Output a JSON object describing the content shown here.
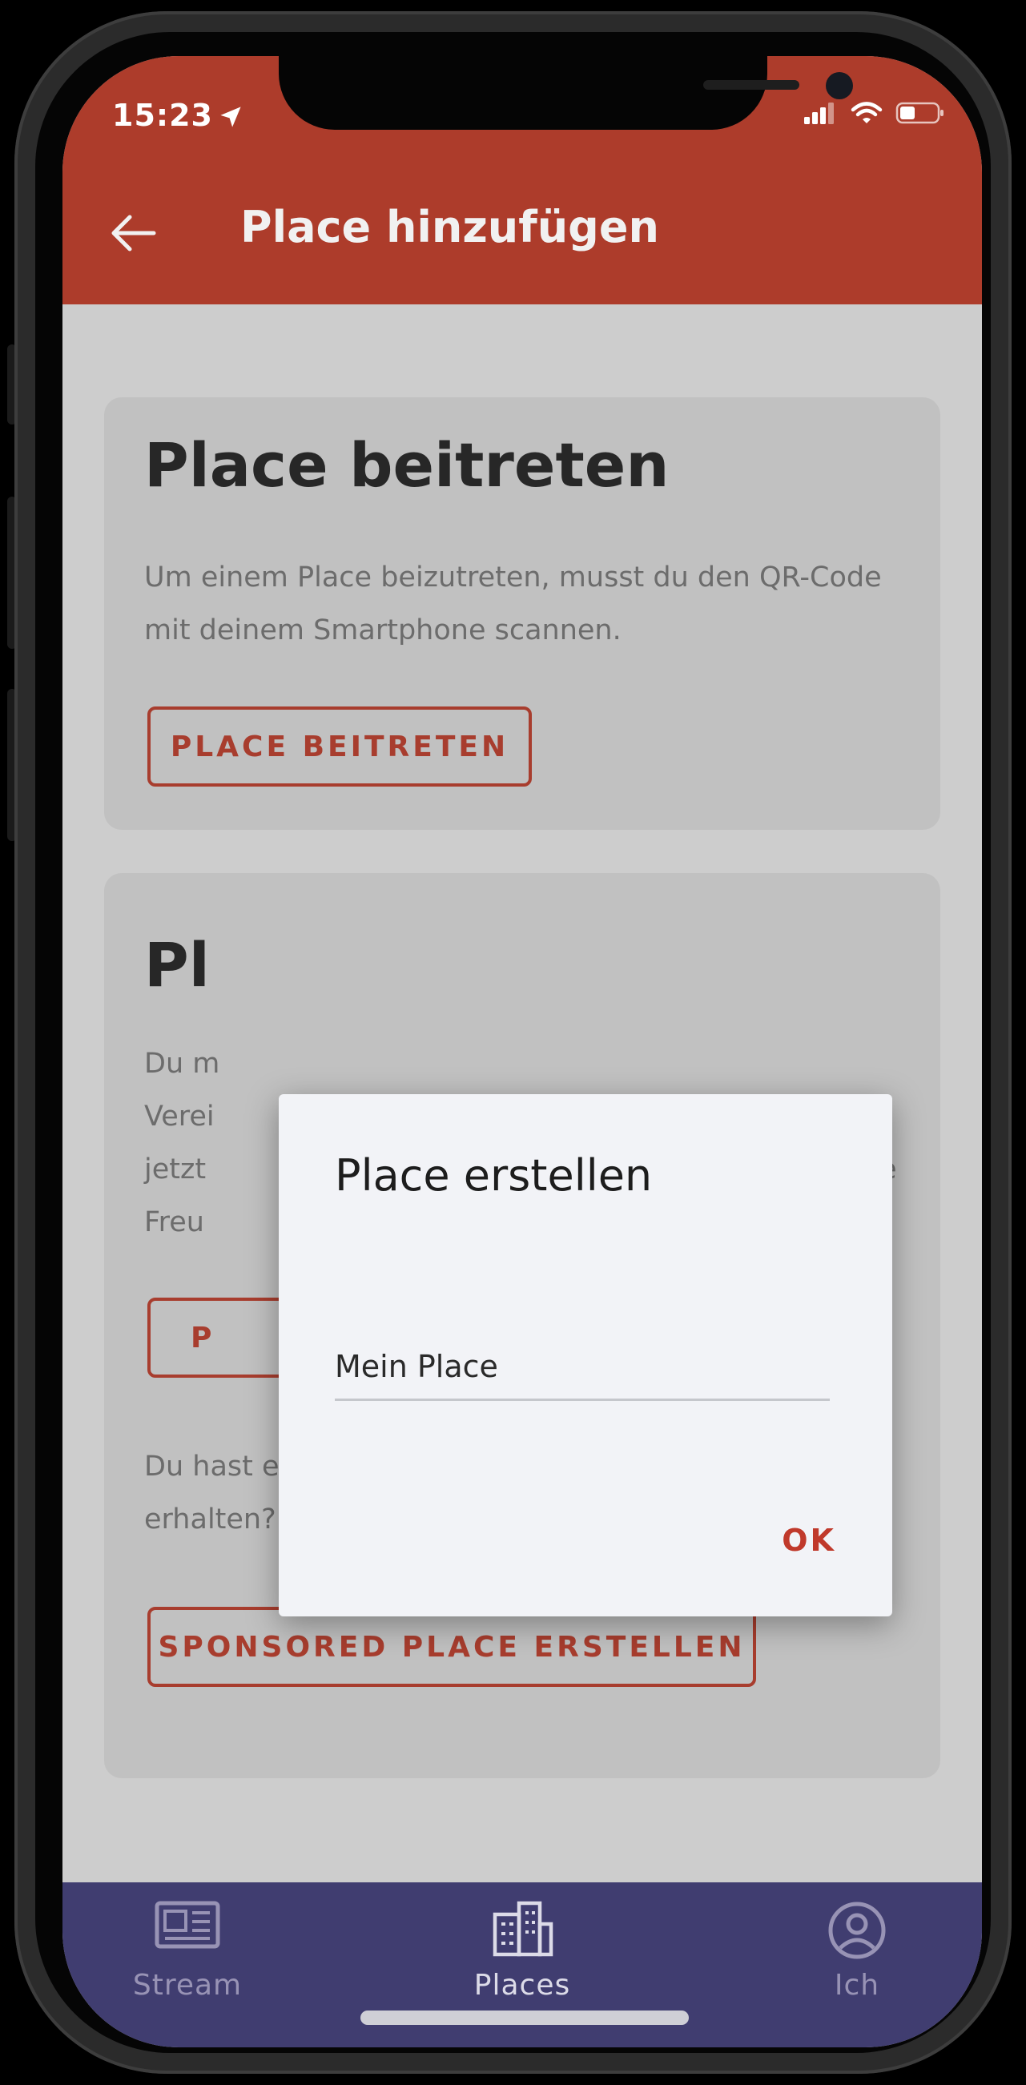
{
  "status_bar": {
    "time": "15:23"
  },
  "app_bar": {
    "title": "Place hinzufügen"
  },
  "join_card": {
    "heading": "Place beitreten",
    "text": "Um einem Place beizutreten, musst du den QR-Code mit deinem Smartphone scannen.",
    "button": "PLACE BEITRETEN"
  },
  "create_card": {
    "heading": "Pl",
    "text_line_1": "Du m",
    "text_line_2": "Verei",
    "text_line_3": "jetzt",
    "text_line_3_tail": "e",
    "text_line_4": "Freu",
    "button_visible": "P",
    "sponsor_text": "Du hast einen Lizenz-Code von einem Sponsor erhalten? Dann erstelle jetzt einen Sponsored-Place.",
    "sponsor_button": "SPONSORED PLACE ERSTELLEN"
  },
  "dialog": {
    "title": "Place erstellen",
    "input_value": "Mein Place",
    "ok_label": "OK"
  },
  "bottom_nav": {
    "items": [
      {
        "label": "Stream",
        "icon": "newspaper-icon",
        "active": false
      },
      {
        "label": "Places",
        "icon": "buildings-icon",
        "active": true
      },
      {
        "label": "Ich",
        "icon": "user-circle-icon",
        "active": false
      }
    ]
  },
  "colors": {
    "app_bar": "#ad3c2b",
    "accent": "#a83d2e",
    "bottom_nav": "#403d70",
    "dialog_bg": "#f2f3f7"
  }
}
